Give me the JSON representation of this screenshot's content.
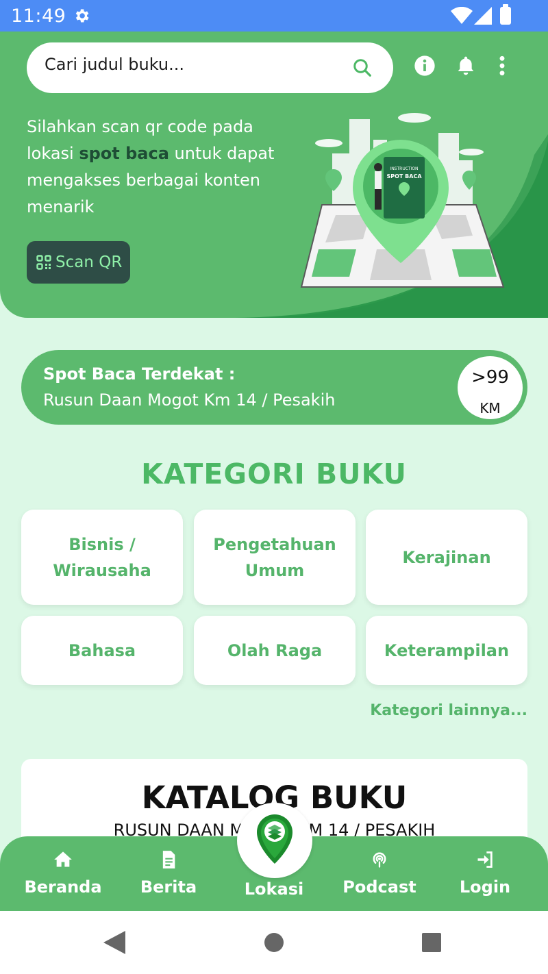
{
  "status_bar": {
    "time": "11:49"
  },
  "search": {
    "placeholder": "Cari judul buku..."
  },
  "hero": {
    "text_before": "Silahkan scan qr code pada lokasi ",
    "text_bold": "spot baca",
    "text_after": " untuk dapat mengakses berbagai konten menarik",
    "scan_label": "Scan QR",
    "illustration_caption_top": "INSTRUCTION",
    "illustration_caption": "SPOT BACA"
  },
  "spot": {
    "title": "Spot Baca Terdekat :",
    "location": "Rusun Daan Mogot Km 14 / Pesakih",
    "distance": ">99",
    "unit": "KM"
  },
  "categories": {
    "title": "KATEGORI BUKU",
    "items": [
      "Bisnis / Wirausaha",
      "Pengetahuan Umum",
      "Kerajinan",
      "Bahasa",
      "Olah Raga",
      "Keterampilan"
    ],
    "more": "Kategori lainnya..."
  },
  "catalog": {
    "title": "KATALOG BUKU",
    "subtitle": "RUSUN DAAN MOGOT KM 14 / PESAKIH"
  },
  "nav": {
    "items": [
      "Beranda",
      "Berita",
      "Lokasi",
      "Podcast",
      "Login"
    ]
  },
  "colors": {
    "primary": "#5cba6e",
    "dark_green": "#2d9a4c",
    "background": "#dcf8e6",
    "status_bar": "#4d8cf5"
  }
}
